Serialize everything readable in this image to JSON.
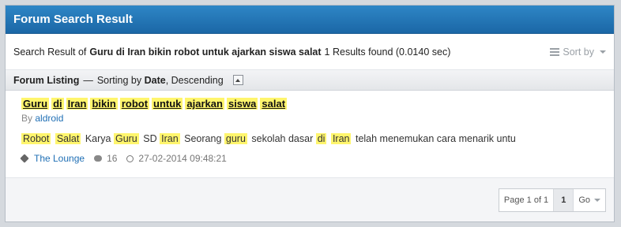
{
  "header": {
    "title": "Forum Search Result"
  },
  "search": {
    "prefix": "Search Result of",
    "query": "Guru di Iran bikin robot untuk ajarkan siswa salat",
    "summary": "1 Results found (0.0140 sec)",
    "sort_label": "Sort by"
  },
  "listing": {
    "label": "Forum Listing",
    "dash": "—",
    "sorting_prefix": "Sorting by",
    "sort_field": "Date",
    "sort_order": ", Descending"
  },
  "result": {
    "title_words": [
      "Guru",
      "di",
      "Iran",
      "bikin",
      "robot",
      "untuk",
      "ajarkan",
      "siswa",
      "salat"
    ],
    "by_prefix": "By",
    "author": "aldroid",
    "snippet": [
      {
        "t": "Robot",
        "h": true
      },
      {
        "t": "Salat",
        "h": true
      },
      {
        "t": "Karya",
        "h": false
      },
      {
        "t": "Guru",
        "h": true
      },
      {
        "t": "SD",
        "h": false
      },
      {
        "t": "Iran",
        "h": true
      },
      {
        "t": "Seorang",
        "h": false
      },
      {
        "t": "guru",
        "h": true
      },
      {
        "t": "sekolah dasar",
        "h": false
      },
      {
        "t": "di",
        "h": true
      },
      {
        "t": "Iran",
        "h": true
      },
      {
        "t": "telah menemukan cara menarik untu",
        "h": false
      }
    ],
    "forum": "The Lounge",
    "replies": "16",
    "datetime": "27-02-2014 09:48:21"
  },
  "pager": {
    "page_info": "Page 1 of 1",
    "current": "1",
    "go": "Go"
  },
  "colors": {
    "header": "#1f6fb5",
    "highlight": "#fff56d",
    "link": "#1f6fb5"
  }
}
